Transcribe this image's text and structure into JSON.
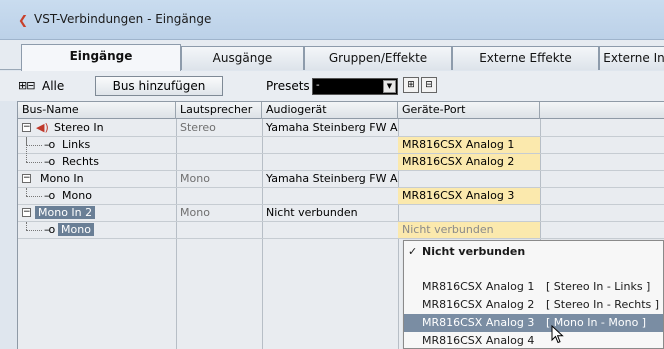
{
  "window": {
    "title": "VST-Verbindungen - Eingänge"
  },
  "tabs": [
    {
      "label": "Eingänge",
      "active": true
    },
    {
      "label": "Ausgänge",
      "active": false
    },
    {
      "label": "Gruppen/Effekte",
      "active": false
    },
    {
      "label": "Externe Effekte",
      "active": false
    },
    {
      "label": "Externe In",
      "active": false
    }
  ],
  "toolbar": {
    "plus_minus": "⊞⊟",
    "all_label": "Alle",
    "add_bus_label": "Bus hinzufügen",
    "presets_label": "Presets",
    "presets_value": "-"
  },
  "columns": {
    "bus_name": "Bus-Name",
    "speaker": "Lautsprecher",
    "device": "Audiogerät",
    "port": "Geräte-Port"
  },
  "rows": [
    {
      "name": "Stereo In",
      "speaker": "Stereo",
      "device": "Yamaha Steinberg FW AS",
      "port": ""
    },
    {
      "name": "Links",
      "speaker": "",
      "device": "",
      "port": "MR816CSX Analog 1"
    },
    {
      "name": "Rechts",
      "speaker": "",
      "device": "",
      "port": "MR816CSX Analog 2"
    },
    {
      "name": "Mono In",
      "speaker": "Mono",
      "device": "Yamaha Steinberg FW AS",
      "port": ""
    },
    {
      "name": "Mono",
      "speaker": "",
      "device": "",
      "port": "MR816CSX Analog 3"
    },
    {
      "name": "Mono In 2",
      "speaker": "Mono",
      "device": "Nicht verbunden",
      "port": ""
    },
    {
      "name": "Mono",
      "speaker": "",
      "device": "",
      "port": "Nicht verbunden"
    }
  ],
  "menu": {
    "header": "Nicht verbunden",
    "items": [
      {
        "port": "MR816CSX Analog 1",
        "assignment": "[ Stereo In - Links ]"
      },
      {
        "port": "MR816CSX Analog 2",
        "assignment": "[ Stereo In - Rechts ]"
      },
      {
        "port": "MR816CSX Analog 3",
        "assignment": "[ Mono In - Mono ]"
      },
      {
        "port": "MR816CSX Analog 4",
        "assignment": ""
      }
    ]
  },
  "colors": {
    "port_highlight": "#fbe9ad",
    "selection": "#6a7f96",
    "menu_hover": "#7a8da3",
    "accent_icon": "#c8402a"
  }
}
